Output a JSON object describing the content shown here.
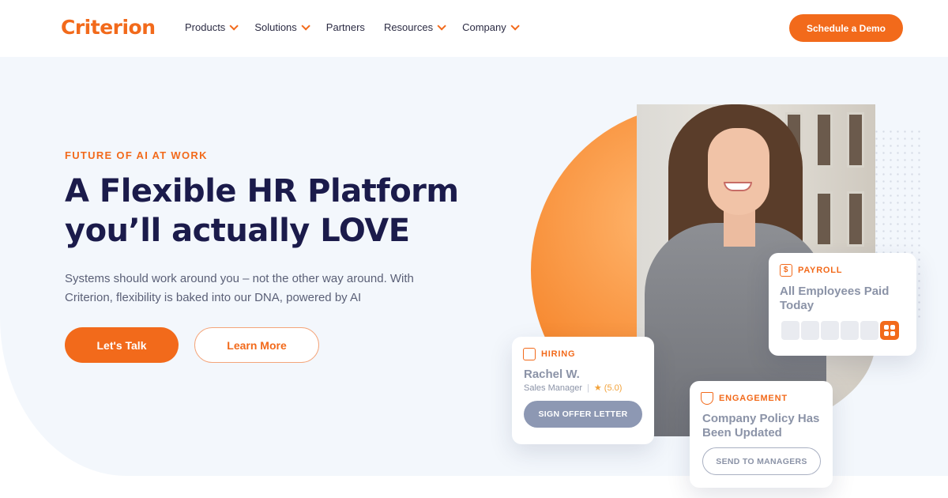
{
  "header": {
    "logo": "Criterion",
    "nav": [
      {
        "label": "Products",
        "dropdown": true
      },
      {
        "label": "Solutions",
        "dropdown": true
      },
      {
        "label": "Partners",
        "dropdown": false
      },
      {
        "label": "Resources",
        "dropdown": true
      },
      {
        "label": "Company",
        "dropdown": true
      }
    ],
    "cta": "Schedule a Demo"
  },
  "hero": {
    "eyebrow": "FUTURE OF AI AT WORK",
    "headline_line1": "A Flexible HR Platform",
    "headline_line2": "you’ll actually LOVE",
    "subtext": "Systems should work around you – not the other way around.  With Criterion, flexibility is baked into our DNA, powered by AI",
    "primary_button": "Let's Talk",
    "secondary_button": "Learn More"
  },
  "cards": {
    "payroll": {
      "label": "PAYROLL",
      "title": "All Employees Paid Today",
      "icon": "dollar-icon"
    },
    "hiring": {
      "label": "HIRING",
      "name": "Rachel W.",
      "role": "Sales Manager",
      "rating": "★ (5.0)",
      "button": "SIGN OFFER LETTER",
      "icon": "building-icon"
    },
    "engagement": {
      "label": "ENGAGEMENT",
      "title": "Company Policy Has Been Updated",
      "button": "SEND TO MANAGERS",
      "icon": "trophy-icon"
    }
  },
  "colors": {
    "accent": "#f26a1b",
    "navy": "#1b1b4b",
    "muted": "#8b93a7",
    "hero_bg": "#f3f7fc"
  }
}
